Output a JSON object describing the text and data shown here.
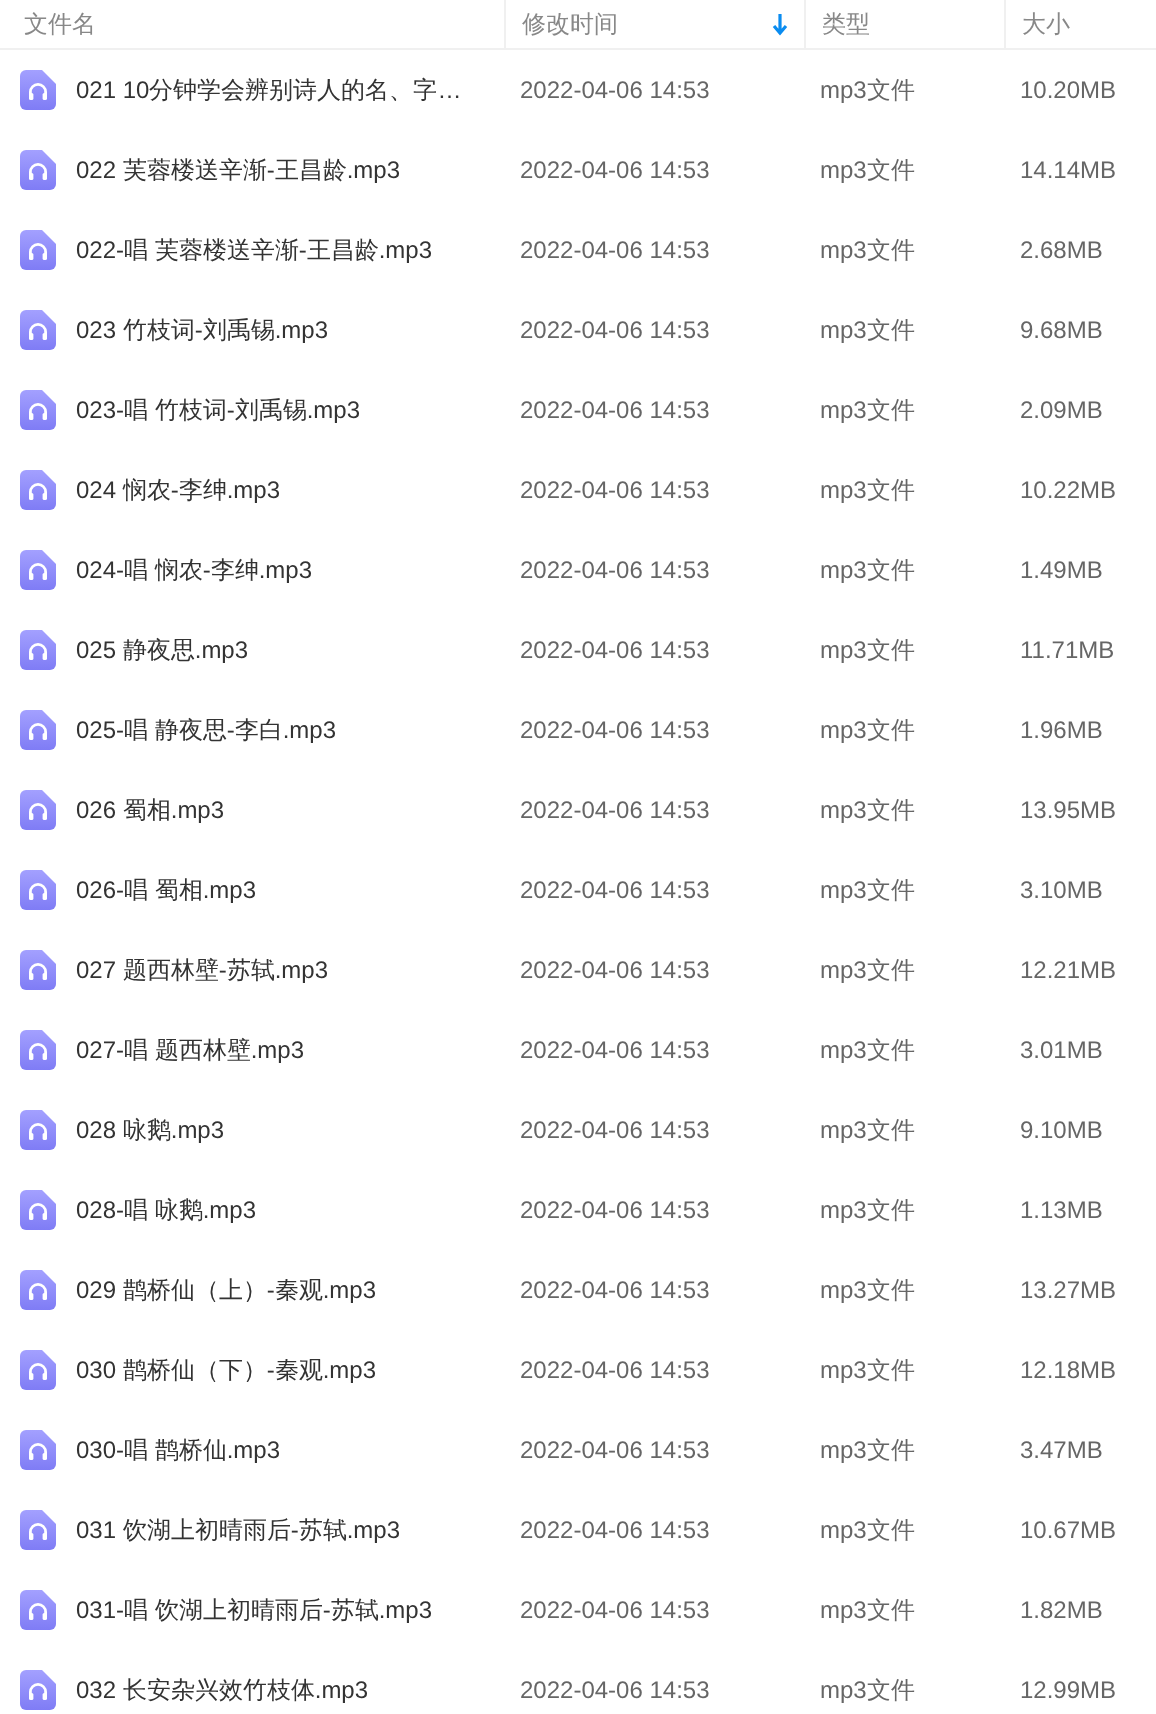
{
  "table": {
    "columns": [
      {
        "label": "文件名",
        "sorted": false
      },
      {
        "label": "修改时间",
        "sorted": true
      },
      {
        "label": "类型",
        "sorted": false
      },
      {
        "label": "大小",
        "sorted": false
      }
    ],
    "rows": [
      {
        "name": "021 10分钟学会辨别诗人的名、字…",
        "modified": "2022-04-06 14:53",
        "type": "mp3文件",
        "size": "10.20MB"
      },
      {
        "name": "022 芙蓉楼送辛渐-王昌龄.mp3",
        "modified": "2022-04-06 14:53",
        "type": "mp3文件",
        "size": "14.14MB"
      },
      {
        "name": "022-唱 芙蓉楼送辛渐-王昌龄.mp3",
        "modified": "2022-04-06 14:53",
        "type": "mp3文件",
        "size": "2.68MB"
      },
      {
        "name": "023 竹枝词-刘禹锡.mp3",
        "modified": "2022-04-06 14:53",
        "type": "mp3文件",
        "size": "9.68MB"
      },
      {
        "name": "023-唱 竹枝词-刘禹锡.mp3",
        "modified": "2022-04-06 14:53",
        "type": "mp3文件",
        "size": "2.09MB"
      },
      {
        "name": "024 悯农-李绅.mp3",
        "modified": "2022-04-06 14:53",
        "type": "mp3文件",
        "size": "10.22MB"
      },
      {
        "name": "024-唱 悯农-李绅.mp3",
        "modified": "2022-04-06 14:53",
        "type": "mp3文件",
        "size": "1.49MB"
      },
      {
        "name": "025 静夜思.mp3",
        "modified": "2022-04-06 14:53",
        "type": "mp3文件",
        "size": "11.71MB"
      },
      {
        "name": "025-唱 静夜思-李白.mp3",
        "modified": "2022-04-06 14:53",
        "type": "mp3文件",
        "size": "1.96MB"
      },
      {
        "name": "026 蜀相.mp3",
        "modified": "2022-04-06 14:53",
        "type": "mp3文件",
        "size": "13.95MB"
      },
      {
        "name": "026-唱 蜀相.mp3",
        "modified": "2022-04-06 14:53",
        "type": "mp3文件",
        "size": "3.10MB"
      },
      {
        "name": "027 题西林壁-苏轼.mp3",
        "modified": "2022-04-06 14:53",
        "type": "mp3文件",
        "size": "12.21MB"
      },
      {
        "name": "027-唱 题西林壁.mp3",
        "modified": "2022-04-06 14:53",
        "type": "mp3文件",
        "size": "3.01MB"
      },
      {
        "name": "028 咏鹅.mp3",
        "modified": "2022-04-06 14:53",
        "type": "mp3文件",
        "size": "9.10MB"
      },
      {
        "name": "028-唱 咏鹅.mp3",
        "modified": "2022-04-06 14:53",
        "type": "mp3文件",
        "size": "1.13MB"
      },
      {
        "name": "029 鹊桥仙（上）-秦观.mp3",
        "modified": "2022-04-06 14:53",
        "type": "mp3文件",
        "size": "13.27MB"
      },
      {
        "name": "030 鹊桥仙（下）-秦观.mp3",
        "modified": "2022-04-06 14:53",
        "type": "mp3文件",
        "size": "12.18MB"
      },
      {
        "name": "030-唱 鹊桥仙.mp3",
        "modified": "2022-04-06 14:53",
        "type": "mp3文件",
        "size": "3.47MB"
      },
      {
        "name": "031 饮湖上初晴雨后-苏轼.mp3",
        "modified": "2022-04-06 14:53",
        "type": "mp3文件",
        "size": "10.67MB"
      },
      {
        "name": "031-唱 饮湖上初晴雨后-苏轼.mp3",
        "modified": "2022-04-06 14:53",
        "type": "mp3文件",
        "size": "1.82MB"
      },
      {
        "name": "032 长安杂兴效竹枝体.mp3",
        "modified": "2022-04-06 14:53",
        "type": "mp3文件",
        "size": "12.99MB"
      }
    ]
  }
}
